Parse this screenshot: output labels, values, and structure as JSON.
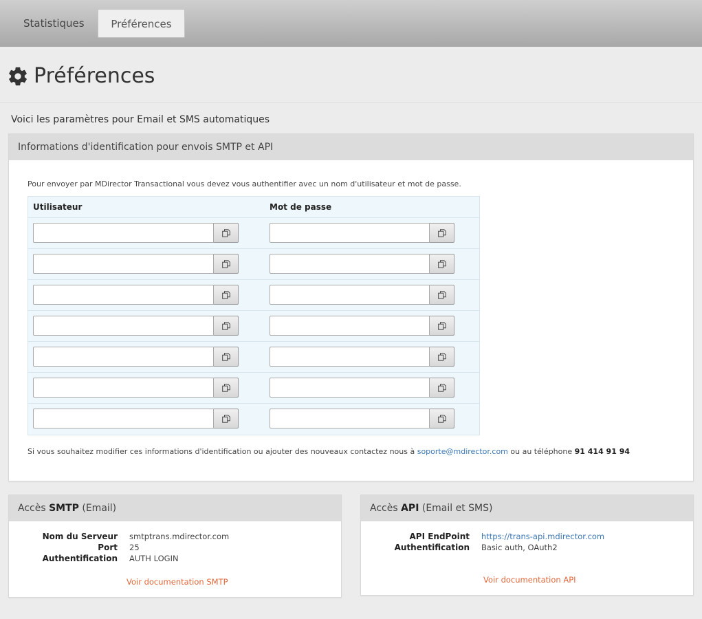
{
  "tabs": [
    {
      "label": "Statistiques"
    },
    {
      "label": "Préférences"
    }
  ],
  "page": {
    "title": "Préférences",
    "intro": "Voici les paramètres pour Email et SMS automatiques"
  },
  "credentials_panel": {
    "title": "Informations d'identification pour envois SMTP et API",
    "note": "Pour envoyer par MDirector Transactional vous devez vous authentifier avec un nom d'utilisateur et mot de passe.",
    "columns": [
      "Utilisateur",
      "Mot de passe"
    ],
    "rows": [
      {
        "user": "",
        "password": ""
      },
      {
        "user": "",
        "password": ""
      },
      {
        "user": "",
        "password": ""
      },
      {
        "user": "",
        "password": ""
      },
      {
        "user": "",
        "password": ""
      },
      {
        "user": "",
        "password": ""
      },
      {
        "user": "",
        "password": ""
      }
    ],
    "contact_prefix": "Si vous souhaitez modifier ces informations d'identification ou ajouter des nouveaux contactez nous à ",
    "contact_email": "soporte@mdirector.com",
    "contact_mid": " ou au téléphone ",
    "contact_phone": "91 414 91 94"
  },
  "smtp_panel": {
    "title_prefix": "Accès ",
    "title_bold": "SMTP",
    "title_suffix": " (Email)",
    "server_label": "Nom du Serveur",
    "server_value": "smtptrans.mdirector.com",
    "port_label": "Port",
    "port_value": "25",
    "auth_label": "Authentification",
    "auth_value": "AUTH LOGIN",
    "doc_link": "Voir documentation SMTP"
  },
  "api_panel": {
    "title_prefix": "Accès ",
    "title_bold": "API",
    "title_suffix": " (Email et SMS)",
    "endpoint_label": "API EndPoint",
    "endpoint_value": "https://trans-api.mdirector.com",
    "auth_label": "Authentification",
    "auth_value": "Basic auth, OAuth2",
    "doc_link": "Voir documentation API"
  },
  "colors": {
    "link": "#3a77b5",
    "doc_link": "#e2673a",
    "table_bg": "#eef7fb",
    "panel_head": "#dcdcdc"
  },
  "icons": {
    "title_icon": "gear-icon",
    "copy_button_icon": "copy-icon"
  }
}
